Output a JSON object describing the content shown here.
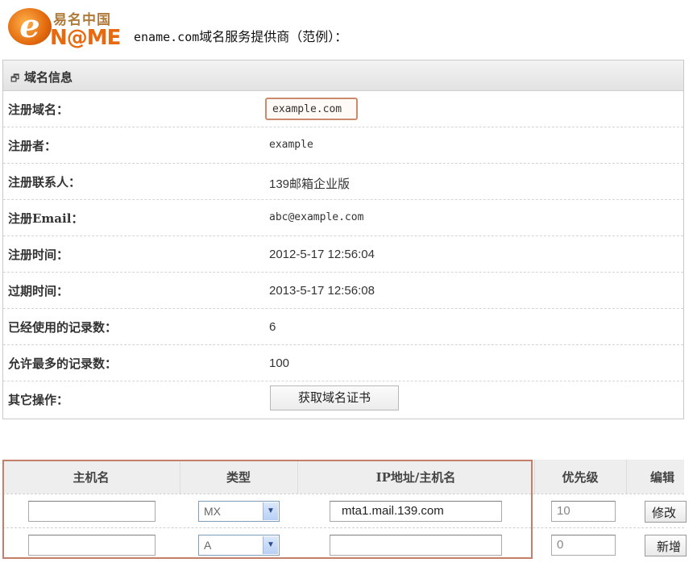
{
  "header": {
    "logo_cn": "易名中国",
    "logo_e": "e",
    "logo_name": "N@ME",
    "title_domain": "ename.com",
    "title_text": "域名服务提供商（范例）："
  },
  "panel": {
    "title": "域名信息",
    "rows": [
      {
        "label": "注册域名：",
        "value": "example.com"
      },
      {
        "label": "注册者：",
        "value": "example"
      },
      {
        "label": "注册联系人：",
        "value": "139邮箱企业版"
      },
      {
        "label": "注册Email：",
        "value": "abc@example.com"
      },
      {
        "label": "注册时间：",
        "value": "2012-5-17 12:56:04"
      },
      {
        "label": "过期时间：",
        "value": "2013-5-17 12:56:08"
      },
      {
        "label": "已经使用的记录数：",
        "value": "6"
      },
      {
        "label": "允许最多的记录数：",
        "value": "100"
      },
      {
        "label": "其它操作：",
        "value": ""
      }
    ],
    "cert_button": "获取域名证书"
  },
  "dns": {
    "headers": [
      "主机名",
      "类型",
      "IP地址/主机名",
      "优先级",
      "编辑"
    ],
    "rows": [
      {
        "host": "",
        "type": "MX",
        "address": "mta1.mail.139.com",
        "priority": "10",
        "action": "修改"
      },
      {
        "host": "",
        "type": "A",
        "address": "",
        "priority": "0",
        "action": "新增"
      }
    ]
  },
  "colors": {
    "highlight_border": "#c37f6a",
    "logo_orange": "#e86a10",
    "select_border": "#7f9db9"
  }
}
